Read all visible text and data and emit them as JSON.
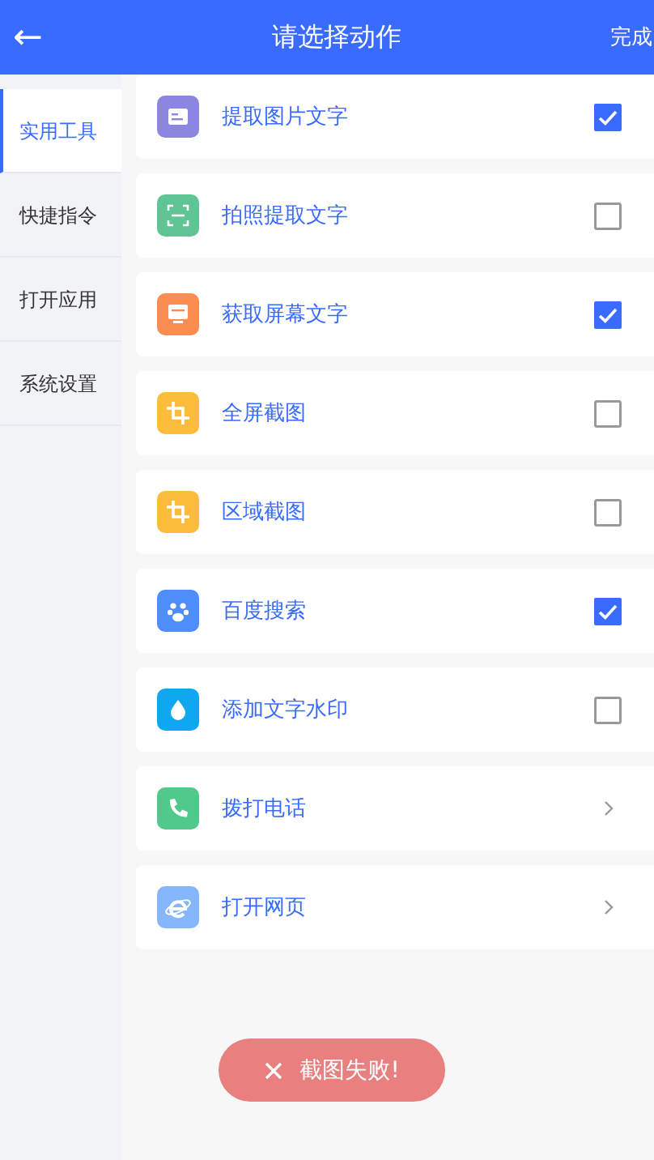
{
  "header": {
    "back": "←",
    "title": "请选择动作",
    "action": "完成"
  },
  "sidebar": {
    "items": [
      {
        "label": "实用工具",
        "selected": true
      },
      {
        "label": "快捷指令",
        "selected": false
      },
      {
        "label": "打开应用",
        "selected": false
      },
      {
        "label": "系统设置",
        "selected": false
      }
    ]
  },
  "actions": [
    {
      "kind": "checkbox",
      "label": "提取图片文字",
      "color": "#8d86e0",
      "checked": true
    },
    {
      "kind": "checkbox",
      "label": "拍照提取文字",
      "color": "#5fc595",
      "checked": false
    },
    {
      "kind": "checkbox",
      "label": "获取屏幕文字",
      "color": "#fc8d52",
      "checked": true
    },
    {
      "kind": "checkbox",
      "label": "全屏截图",
      "color": "#fbbd3b",
      "checked": false
    },
    {
      "kind": "checkbox",
      "label": "区域截图",
      "color": "#fbbd3b",
      "checked": false
    },
    {
      "kind": "checkbox",
      "label": "百度搜索",
      "color": "#4e8dfa",
      "checked": true
    },
    {
      "kind": "checkbox",
      "label": "添加文字水印",
      "color": "#0fa7ef",
      "checked": false
    },
    {
      "kind": "link",
      "label": "拨打电话",
      "color": "#50c98a"
    },
    {
      "kind": "link",
      "label": "打开网页",
      "color": "#86b6fb"
    }
  ],
  "toast": {
    "message": "截图失败!"
  }
}
